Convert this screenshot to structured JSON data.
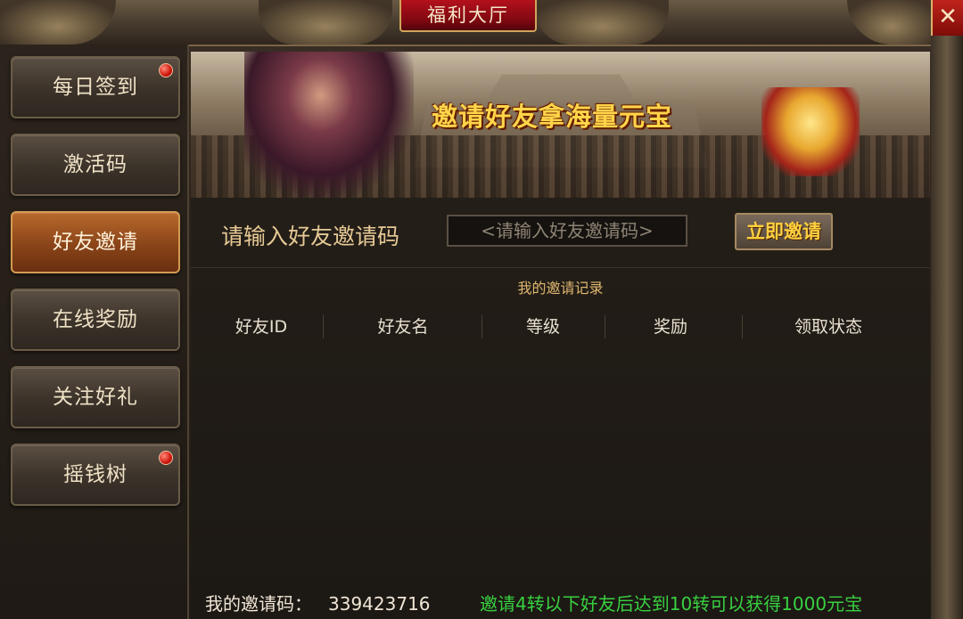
{
  "window": {
    "title": "福利大厅",
    "close_symbol": "✕"
  },
  "sidebar": {
    "items": [
      {
        "label": "每日签到",
        "active": false,
        "badge": true
      },
      {
        "label": "激活码",
        "active": false,
        "badge": false
      },
      {
        "label": "好友邀请",
        "active": true,
        "badge": false
      },
      {
        "label": "在线奖励",
        "active": false,
        "badge": false
      },
      {
        "label": "关注好礼",
        "active": false,
        "badge": false
      },
      {
        "label": "摇钱树",
        "active": false,
        "badge": true
      }
    ]
  },
  "banner": {
    "headline": "邀请好友拿海量元宝"
  },
  "invite": {
    "label": "请输入好友邀请码",
    "placeholder": "<请输入好友邀请码>",
    "button": "立即邀请"
  },
  "records": {
    "title": "我的邀请记录",
    "columns": [
      "好友ID",
      "好友名",
      "等级",
      "奖励",
      "领取状态"
    ],
    "rows": []
  },
  "footer": {
    "code_label": "我的邀请码：",
    "code_value": "339423716",
    "note": "邀请4转以下好友后达到10转可以获得1000元宝"
  },
  "colors": {
    "accent_gold": "#e6c995",
    "note_green": "#38d040",
    "active_tab": "#8a4418",
    "badge_red": "#d0160c"
  }
}
